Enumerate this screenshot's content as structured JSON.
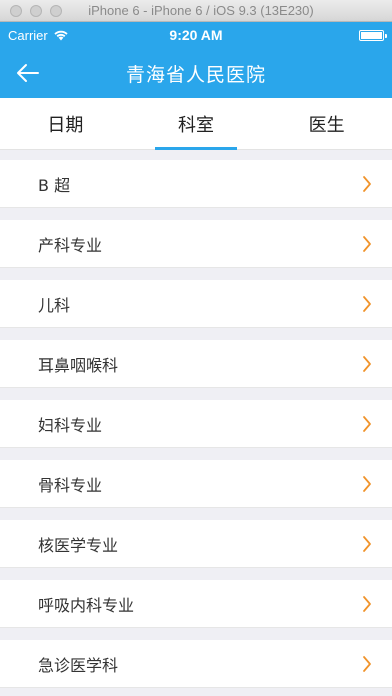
{
  "simulator": {
    "window_title": "iPhone 6 - iPhone 6 / iOS 9.3 (13E230)"
  },
  "status_bar": {
    "carrier": "Carrier",
    "time": "9:20 AM",
    "battery_level": 1.0
  },
  "nav": {
    "title": "青海省人民医院",
    "back_icon": "arrow-left-icon"
  },
  "tabs": [
    {
      "label": "日期",
      "active": false
    },
    {
      "label": "科室",
      "active": true
    },
    {
      "label": "医生",
      "active": false
    }
  ],
  "departments": [
    {
      "label": "B 超"
    },
    {
      "label": "产科专业"
    },
    {
      "label": "儿科"
    },
    {
      "label": "耳鼻咽喉科"
    },
    {
      "label": "妇科专业"
    },
    {
      "label": "骨科专业"
    },
    {
      "label": "核医学专业"
    },
    {
      "label": "呼吸内科专业"
    },
    {
      "label": "急诊医学科"
    }
  ],
  "colors": {
    "primary": "#2aa6eb",
    "chevron": "#f0932b",
    "background": "#efeff4"
  }
}
